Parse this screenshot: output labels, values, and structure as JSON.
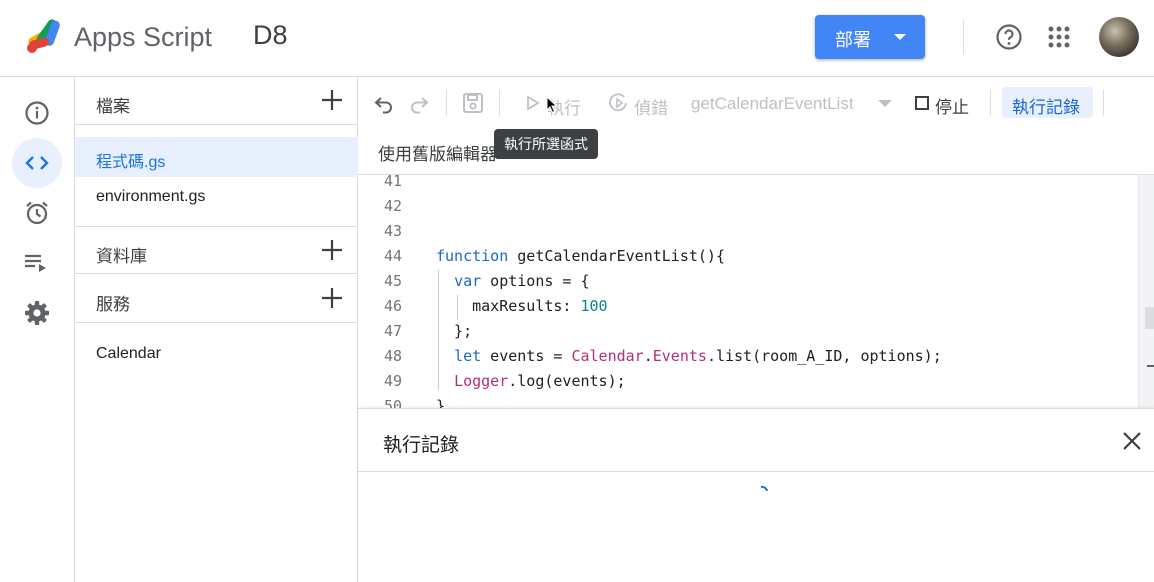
{
  "header": {
    "app_name": "Apps Script",
    "project_name": "D8",
    "deploy_label": "部署"
  },
  "files_panel": {
    "files_section": "檔案",
    "files": [
      "程式碼.gs",
      "environment.gs"
    ],
    "selected_file": "程式碼.gs",
    "libraries_section": "資料庫",
    "services_section": "服務",
    "services": [
      "Calendar"
    ]
  },
  "toolbar": {
    "run_label": "執行",
    "debug_label": "偵錯",
    "function_select": "getCalendarEventList",
    "stop_label": "停止",
    "log_label": "執行記錄",
    "legacy_editor": "使用舊版編輯器",
    "tooltip": "執行所選函式"
  },
  "editor": {
    "lines": [
      {
        "n": "41",
        "code": ""
      },
      {
        "n": "42",
        "code": ""
      },
      {
        "n": "43",
        "code": ""
      },
      {
        "n": "44",
        "code": "function getCalendarEventList(){"
      },
      {
        "n": "45",
        "code": "  var options = {"
      },
      {
        "n": "46",
        "code": "    maxResults: 100"
      },
      {
        "n": "47",
        "code": "  };"
      },
      {
        "n": "48",
        "code": "  let events = Calendar.Events.list(room_A_ID, options);"
      },
      {
        "n": "49",
        "code": "  Logger.log(events);"
      },
      {
        "n": "50",
        "code": "}"
      }
    ]
  },
  "log_panel": {
    "title": "執行記錄"
  },
  "colors": {
    "accent": "#4285f4",
    "selected_bg": "#e8f0fe",
    "selected_text": "#1a73e8"
  }
}
